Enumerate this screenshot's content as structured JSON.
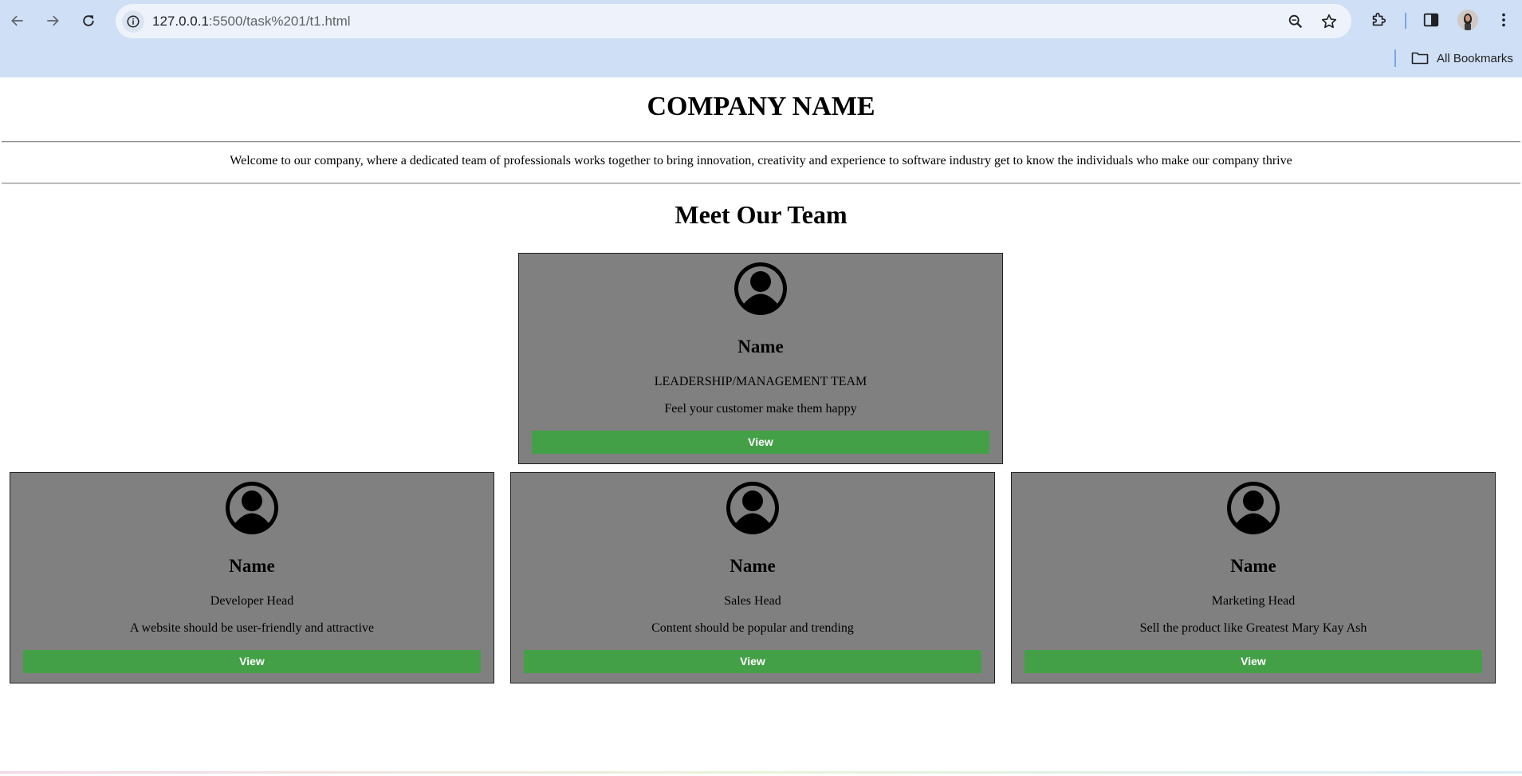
{
  "browser": {
    "url_host": "127.0.0.1",
    "url_path": ":5500/task%201/t1.html",
    "bookmarks_label": "All Bookmarks"
  },
  "page": {
    "company_name": "COMPANY NAME",
    "welcome_text": "Welcome to our company, where a dedicated team of professionals works together to bring innovation, creativity and experience to software industry get to know the individuals who make our company thrive",
    "team_title": "Meet Our Team",
    "cards": [
      {
        "name": "Name",
        "role": "LEADERSHIP/MANAGEMENT TEAM",
        "quote": "Feel your customer make them happy",
        "button": "View"
      },
      {
        "name": "Name",
        "role": "Developer Head",
        "quote": "A website should be user-friendly and attractive",
        "button": "View"
      },
      {
        "name": "Name",
        "role": "Sales Head",
        "quote": "Content should be popular and trending",
        "button": "View"
      },
      {
        "name": "Name",
        "role": "Marketing Head",
        "quote": "Sell the product like Greatest Mary Kay Ash",
        "button": "View"
      }
    ]
  },
  "colors": {
    "chrome_bg": "#cfdff5",
    "card_bg": "#808080",
    "button_bg": "#43a047",
    "button_text": "#ffffff"
  },
  "icons": {
    "back": "arrow-left-icon",
    "forward": "arrow-right-icon",
    "reload": "reload-icon",
    "site_info": "info-icon",
    "zoom": "magnifier-icon",
    "bookmark_star": "star-icon",
    "extensions": "puzzle-icon",
    "side_panel": "side-panel-icon",
    "menu": "kebab-menu-icon",
    "bookmark_folder": "folder-icon",
    "card_avatar": "user-avatar-icon"
  }
}
